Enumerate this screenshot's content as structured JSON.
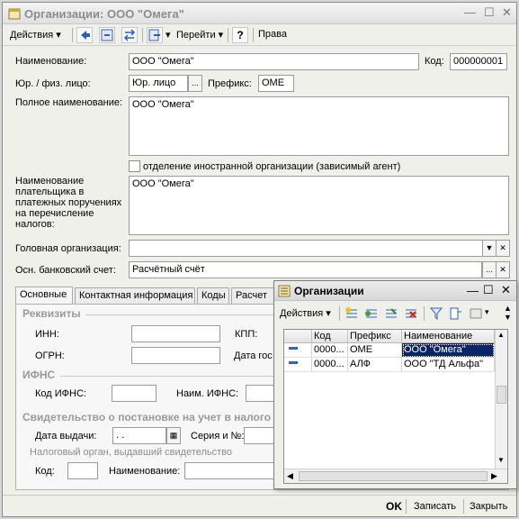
{
  "window": {
    "title": "Организации: ООО \"Омега\"",
    "controls": {
      "min": "—",
      "max": "☐",
      "close": "✕"
    }
  },
  "toolbar": {
    "actions": "Действия",
    "goto": "Перейти",
    "help": "?",
    "rights": "Права"
  },
  "form": {
    "name_label": "Наименование:",
    "name_value": "ООО \"Омега\"",
    "code_label": "Код:",
    "code_value": "000000001",
    "type_label": "Юр. / физ. лицо:",
    "type_value": "Юр. лицо",
    "prefix_label": "Префикс:",
    "prefix_value": "OME",
    "fullname_label": "Полное наименование:",
    "fullname_value": "ООО \"Омега\"",
    "foreign_label": "отделение иностранной организации (зависимый агент)",
    "payer_label": "Наименование плательщика в платежных поручениях на перечисление налогов:",
    "payer_value": "ООО \"Омега\"",
    "head_label": "Головная организация:",
    "head_value": "",
    "bank_label": "Осн. банковский счет:",
    "bank_value": "Расчётный счёт"
  },
  "tabs": [
    "Основные",
    "Контактная информация",
    "Коды",
    "Расчет"
  ],
  "main_tab": {
    "requisites": "Реквизиты",
    "inn": "ИНН:",
    "kpp": "КПП:",
    "ogrn": "ОГРН:",
    "date_label": "Дата гос",
    "ifns_section": "ИФНС",
    "ifns_code": "Код ИФНС:",
    "ifns_name": "Наим. ИФНС:",
    "cert_section": "Свидетельство о постановке на учет в налого",
    "issue_date": "Дата выдачи:",
    "issue_date_value": " .  .",
    "series": "Серия и №:",
    "tax_body": "Налоговый орган, выдавший свидетельство",
    "code": "Код:",
    "name": "Наименование:"
  },
  "bottom": {
    "ok": "OK",
    "save": "Записать",
    "close": "Закрыть"
  },
  "popup": {
    "title": "Организации",
    "actions": "Действия",
    "columns": [
      "Код",
      "Префикс",
      "Наименование"
    ],
    "rows": [
      {
        "code": "0000...",
        "prefix": "OME",
        "name": "ООО \"Омега\"",
        "selected": true
      },
      {
        "code": "0000...",
        "prefix": "АЛФ",
        "name": "ООО \"ТД Альфа\"",
        "selected": false
      }
    ]
  },
  "colors": {
    "selection": "#0a246a",
    "section_gray": "#9a9a9a"
  }
}
